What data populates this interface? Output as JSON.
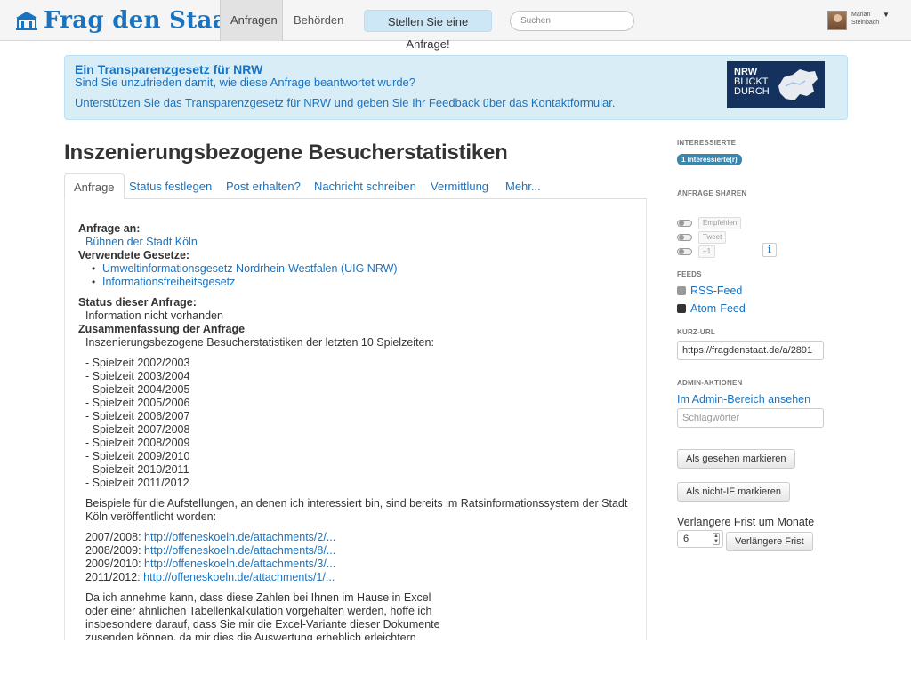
{
  "brand": {
    "name": "Frag den Staat",
    "icon": "building-icon"
  },
  "nav": {
    "tabs": [
      "Anfragen",
      "Behörden"
    ],
    "active": "Anfragen",
    "cta": "Stellen Sie eine Anfrage!"
  },
  "search": {
    "placeholder": "Suchen",
    "value": ""
  },
  "user": {
    "name": "Marian Steinbach"
  },
  "banner": {
    "title": "Ein Transparenzgesetz für NRW",
    "subtitle": "Sind Sie unzufrieden damit, wie diese Anfrage beantwortet wurde?",
    "link": "Unterstützen Sie das Transparenzgesetz für NRW und geben Sie Ihr Feedback über das Kontaktformular.",
    "logo": {
      "line1": "NRW",
      "line2": "BLICKT",
      "line3": "DURCH"
    }
  },
  "page": {
    "title": "Inszenierungsbezogene Besucherstatistiken"
  },
  "tabs": [
    "Anfrage",
    "Status festlegen",
    "Post erhalten?",
    "Nachricht schreiben",
    "Vermittlung",
    "Mehr..."
  ],
  "content": {
    "to_label": "Anfrage an:",
    "to_value": "Bühnen der Stadt Köln",
    "laws_label": "Verwendete Gesetze:",
    "laws": [
      "Umweltinformationsgesetz Nordrhein-Westfalen (UIG NRW)",
      "Informationsfreiheitsgesetz"
    ],
    "status_label": "Status dieser Anfrage:",
    "status_value": "Information nicht vorhanden",
    "summary_label": "Zusammenfassung der Anfrage",
    "summary_intro": "Inszenierungsbezogene Besucherstatistiken der letzten 10 Spielzeiten:",
    "seasons": [
      "- Spielzeit 2002/2003",
      "- Spielzeit 2003/2004",
      "- Spielzeit 2004/2005",
      "- Spielzeit 2005/2006",
      "- Spielzeit 2006/2007",
      "- Spielzeit 2007/2008",
      "- Spielzeit 2008/2009",
      "- Spielzeit 2009/2010",
      "- Spielzeit 2010/2011",
      "- Spielzeit 2011/2012"
    ],
    "examples_text": [
      "Beispiele für die Aufstellungen, an denen ich interessiert bin, sind bereits im Ratsinformationssystem der Stadt",
      "Köln veröffentlicht worden:"
    ],
    "examples": [
      {
        "label": "2007/2008:",
        "link": "http://offeneskoeln.de/attachments/2/..."
      },
      {
        "label": "2008/2009:",
        "link": "http://offeneskoeln.de/attachments/8/..."
      },
      {
        "label": "2009/2010:",
        "link": "http://offeneskoeln.de/attachments/3/..."
      },
      {
        "label": "2011/2012:",
        "link": "http://offeneskoeln.de/attachments/1/..."
      }
    ],
    "closing": [
      "Da ich annehme kann, dass diese Zahlen bei Ihnen im Hause in Excel",
      "oder einer ähnlichen Tabellenkalkulation vorgehalten werden, hoffe ich",
      "insbesondere darauf, dass Sie mir die Excel-Variante dieser Dokumente",
      "zusenden können, da mir dies die Auswertung erheblich erleichtern"
    ]
  },
  "sidebar": {
    "interested_heading": "Interessierte",
    "interested_badge": "1 Interessierte(r)",
    "share_heading": "Anfrage sharen",
    "share_buttons": [
      "Empfehlen",
      "Tweet",
      "+1"
    ],
    "feeds_heading": "Feeds",
    "feeds": [
      "RSS-Feed",
      "Atom-Feed"
    ],
    "shorturl_heading": "Kurz-URL",
    "shorturl_value": "https://fragdenstaat.de/a/2891",
    "admin_heading": "Admin-Aktionen",
    "admin_link": "Im Admin-Bereich ansehen",
    "tags_placeholder": "Schlagwörter",
    "btn_seen": "Als gesehen markieren",
    "btn_not_if": "Als nicht-IF markieren",
    "extend_label": "Verlängere Frist um Monate",
    "extend_value": "6",
    "btn_extend": "Verlängere Frist"
  },
  "colors": {
    "link": "#1a73c0",
    "banner_bg": "#d9edf7",
    "badge": "#3a87ad",
    "logo_bg": "#15325e"
  }
}
